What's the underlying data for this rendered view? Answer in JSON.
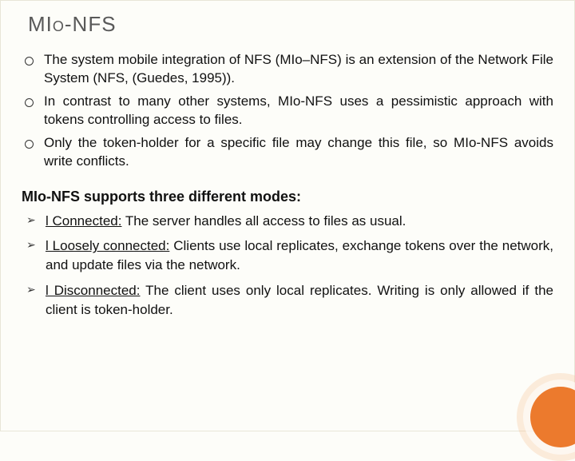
{
  "title_main": "MI",
  "title_suffix": "o-NFS",
  "bullets": [
    "The system mobile integration of NFS (MIo–NFS) is an extension of the Network File System (NFS, (Guedes, 1995)).",
    "In contrast to many other systems, MIo-NFS uses a pessimistic approach with tokens controlling access to files.",
    "Only the token-holder for a specific file may change this file, so MIo-NFS avoids write conflicts."
  ],
  "section_heading": "MIo-NFS supports three different modes:",
  "modes": [
    {
      "label": "l Connected:",
      "text": " The server handles all access to files as usual."
    },
    {
      "label": "l Loosely connected:",
      "text": " Clients use local replicates, exchange tokens over the network, and update files via the network."
    },
    {
      "label": "l Disconnected:",
      "text": " The client uses only local replicates. Writing is only allowed if the client is token-holder."
    }
  ]
}
